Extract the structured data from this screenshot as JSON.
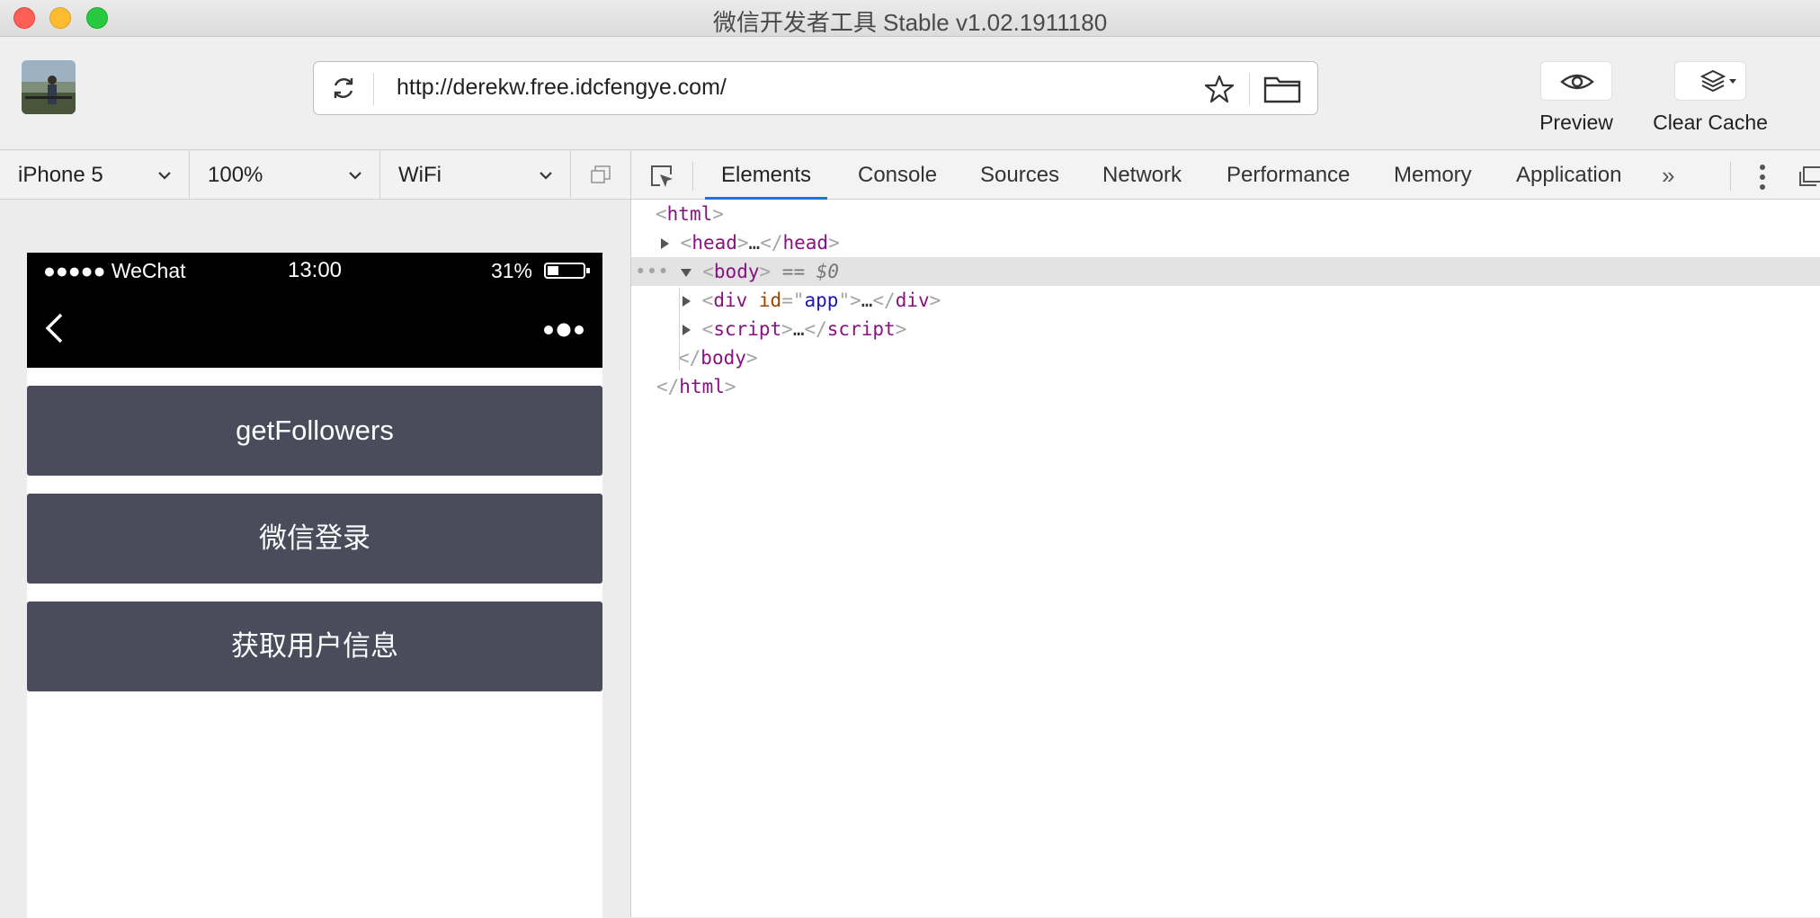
{
  "window": {
    "title": "微信开发者工具 Stable v1.02.1911180"
  },
  "toolbar": {
    "url": "http://derekw.free.idcfengye.com/",
    "preview_label": "Preview",
    "clear_cache_label": "Clear Cache"
  },
  "simulator_controls": {
    "device": "iPhone 5",
    "zoom": "100%",
    "network": "WiFi"
  },
  "devtools": {
    "tabs": [
      "Elements",
      "Console",
      "Sources",
      "Network",
      "Performance",
      "Memory",
      "Application"
    ],
    "active_tab": "Elements",
    "more_tabs": "»"
  },
  "phone": {
    "carrier": "●●●●● WeChat",
    "time": "13:00",
    "battery": "31%",
    "buttons": [
      "getFollowers",
      "微信登录",
      "获取用户信息"
    ]
  },
  "elements_tree": {
    "html_open": "html",
    "head": "head",
    "body": "body",
    "body_ref": "== $0",
    "div_tag": "div",
    "div_attr_name": "id",
    "div_attr_value": "app",
    "script_tag": "script",
    "ellipsis": "…",
    "row_dots": "•••"
  },
  "colors": {
    "button_bg": "#4b4c5b",
    "active_tab_underline": "#1a73e8",
    "close": "#fe5f57",
    "minimize": "#febc2e",
    "zoom": "#28c840"
  }
}
